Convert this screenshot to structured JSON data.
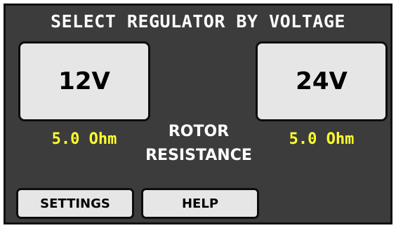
{
  "title": "SELECT REGULATOR BY VOLTAGE",
  "regulators": [
    {
      "label": "12V",
      "resistance": "5.0 Ohm"
    },
    {
      "label": "24V",
      "resistance": "5.0 Ohm"
    }
  ],
  "rotor_resistance": {
    "line1": "ROTOR",
    "line2": "RESISTANCE"
  },
  "buttons": {
    "settings": "SETTINGS",
    "help": "HELP"
  },
  "colors": {
    "background": "#3c3c3c",
    "button": "#e6e6e6",
    "resistance_text": "#ffff2e",
    "label_text": "#ffffff"
  }
}
